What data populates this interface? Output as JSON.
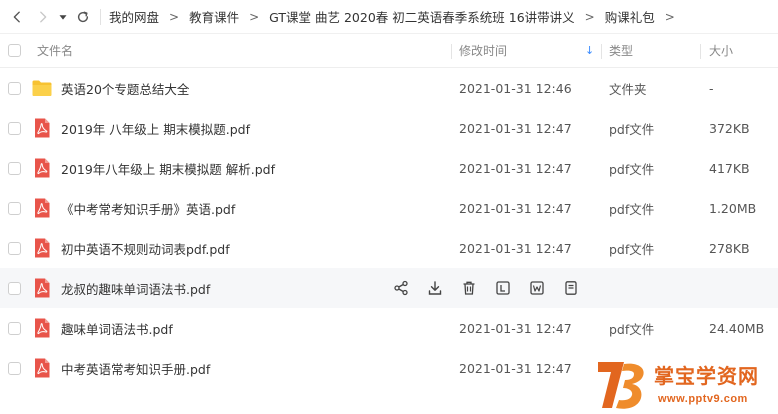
{
  "nav": {
    "breadcrumb": [
      "我的网盘",
      "教育课件",
      "GT课堂 曲艺 2020春 初二英语春季系统班 16讲带讲义",
      "购课礼包"
    ],
    "separator": ">"
  },
  "header": {
    "name": "文件名",
    "time": "修改时间",
    "sort_indicator": "↓",
    "type": "类型",
    "size": "大小"
  },
  "files": [
    {
      "name": "英语20个专题总结大全",
      "time": "2021-01-31 12:46",
      "type": "文件夹",
      "size": "-",
      "kind": "folder-icon"
    },
    {
      "name": "2019年 八年级上 期末模拟题.pdf",
      "time": "2021-01-31 12:47",
      "type": "pdf文件",
      "size": "372KB",
      "kind": "pdf-icon"
    },
    {
      "name": "2019年八年级上 期末模拟题 解析.pdf",
      "time": "2021-01-31 12:47",
      "type": "pdf文件",
      "size": "417KB",
      "kind": "pdf-icon"
    },
    {
      "name": "《中考常考知识手册》英语.pdf",
      "time": "2021-01-31 12:47",
      "type": "pdf文件",
      "size": "1.20MB",
      "kind": "pdf-icon"
    },
    {
      "name": "初中英语不规则动词表pdf.pdf",
      "time": "2021-01-31 12:47",
      "type": "pdf文件",
      "size": "278KB",
      "kind": "pdf-icon"
    },
    {
      "name": "龙叔的趣味单词语法书.pdf",
      "time": "",
      "type": "",
      "size": "",
      "kind": "pdf-icon",
      "hovered": true
    },
    {
      "name": "趣味单词语法书.pdf",
      "time": "2021-01-31 12:47",
      "type": "pdf文件",
      "size": "24.40MB",
      "kind": "pdf-icon"
    },
    {
      "name": "中考英语常考知识手册.pdf",
      "time": "2021-01-31 12:47",
      "type": "",
      "size": "",
      "kind": "pdf-icon"
    }
  ],
  "hover_actions": [
    "share-icon",
    "download-icon",
    "delete-icon",
    "rename-icon",
    "move-icon",
    "more-icon"
  ],
  "colors": {
    "pdf": "#e8544a",
    "folder": "#f7c232",
    "accent": "#3b8cff",
    "watermark": "#e2661f"
  },
  "watermark": {
    "text": "掌宝学资网",
    "url": "www.pptv9.com"
  }
}
